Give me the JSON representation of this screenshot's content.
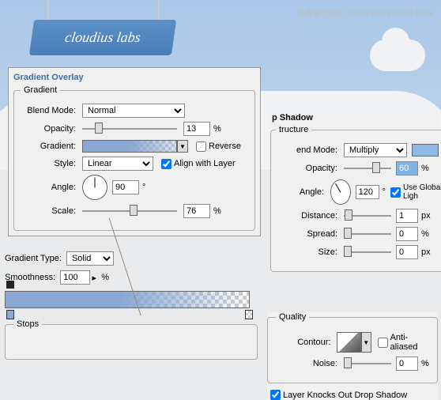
{
  "watermark": {
    "main": "思缘设计论坛",
    "sub": "WWW.MISSYUAN.COM"
  },
  "signText": "cloudius labs",
  "gradOverlay": {
    "title": "Gradient Overlay",
    "legend": "Gradient",
    "blendModeLabel": "Blend Mode:",
    "blendMode": "Normal",
    "opacityLabel": "Opacity:",
    "opacity": "13",
    "pct": "%",
    "gradientLabel": "Gradient:",
    "reverseLabel": "Reverse",
    "styleLabel": "Style:",
    "style": "Linear",
    "alignLabel": "Align with Layer",
    "angleLabel": "Angle:",
    "angle": "90",
    "deg": "°",
    "scaleLabel": "Scale:",
    "scale": "76"
  },
  "dropShadow": {
    "title": "p Shadow",
    "legend": "tructure",
    "blendModeLabel": "end Mode:",
    "blendMode": "Multiply",
    "swatchColor": "#8fb8e5",
    "opacityLabel": "Opacity:",
    "opacity": "60",
    "pct": "%",
    "angleLabel": "Angle:",
    "angle": "120",
    "deg": "°",
    "globalLabel": "Use Global Ligh",
    "distanceLabel": "Distance:",
    "distance": "1",
    "spreadLabel": "Spread:",
    "spread": "0",
    "sizeLabel": "Size:",
    "size": "0",
    "px": "px"
  },
  "gradEditor": {
    "typeLabel": "Gradient Type:",
    "type": "Solid",
    "smoothLabel": "Smoothness:",
    "smooth": "100",
    "pct": "%",
    "stopsLegend": "Stops"
  },
  "quality": {
    "legend": "Quality",
    "contourLabel": "Contour:",
    "antiLabel": "Anti-aliased",
    "noiseLabel": "Noise:",
    "noise": "0",
    "pct": "%",
    "knockoutLabel": "Layer Knocks Out Drop Shadow"
  }
}
